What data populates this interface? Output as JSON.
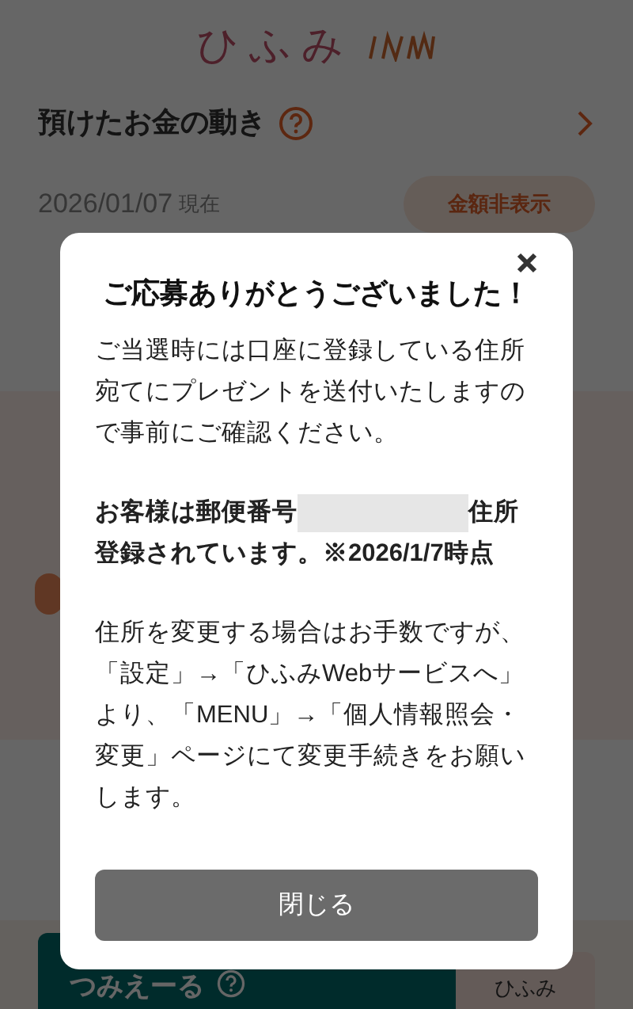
{
  "header": {
    "logo": "ひふみ"
  },
  "section": {
    "title": "預けたお金の動き",
    "date": "2026/01/07",
    "date_suffix": "現在",
    "hide_button": "金額非表示"
  },
  "bottom_bar": {
    "main_button": "つみえーる",
    "side_lines": [
      "ひふみ"
    ]
  },
  "dialog": {
    "title": "ご応募ありがとうございました！",
    "paragraphs": [
      {
        "kind": "plain",
        "text": "ご当選時には口座に登録している住所宛てにプレゼントを送付いたしますので事前にご確認ください。"
      },
      {
        "kind": "masked",
        "lead": "お客様は郵便番号",
        "masked": true,
        "tail": "住所登録されています。※2026/1/7時点"
      },
      {
        "kind": "plain",
        "text": "住所を変更する場合はお手数ですが、「設定」→「ひふみWebサービスへ」より、「MENU」→「個人情報照会・変更」ページにて変更手続きをお願いします。"
      }
    ],
    "close_button": "閉じる"
  }
}
